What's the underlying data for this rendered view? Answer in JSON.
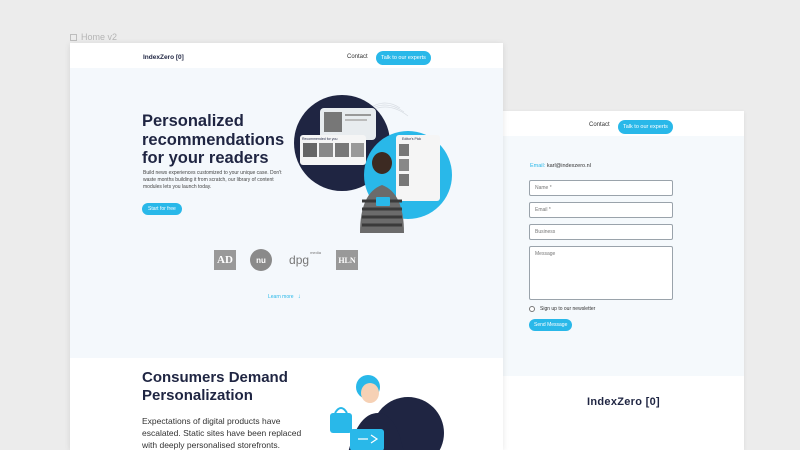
{
  "frame_label": "Home v2",
  "main": {
    "logo": "IndexZero [0]",
    "nav": {
      "contact": "Contact",
      "cta": "Talk to our experts"
    },
    "hero": {
      "title": "Personalized recommendations for your readers",
      "description": "Build news experiences customized to your unique case. Don't waste months building it from scratch, our library of content modules lets you launch today.",
      "cta": "Start for free",
      "card_labels": {
        "rec_for_you": "Recommended for you",
        "editors_pick": "Editor's Pick"
      }
    },
    "brands": {
      "ad": "AD",
      "nu": "nu",
      "dpg": "dpg",
      "dpg_small": "media",
      "hln": "HLN"
    },
    "learn_more": "Learn more",
    "section2": {
      "title": "Consumers Demand Personalization",
      "description": "Expectations of digital products have escalated. Static sites have been replaced with deeply personalised storefronts."
    }
  },
  "contact_page": {
    "nav": {
      "contact": "Contact",
      "cta": "Talk to our experts"
    },
    "email_label": "Email:",
    "email_value": "karl@indexzero.nl",
    "fields": {
      "name": "Name *",
      "email": "Email *",
      "business": "Business",
      "message": "Message"
    },
    "newsletter": "Sign up to our newsletter",
    "send": "Send Message",
    "footer_logo": "IndexZero [0]"
  },
  "colors": {
    "accent": "#29b8e9",
    "navy": "#1f2542",
    "hero_bg": "#f4f8fc"
  },
  "icons": [
    "frame-icon",
    "arrow-down-icon",
    "radio-icon"
  ]
}
